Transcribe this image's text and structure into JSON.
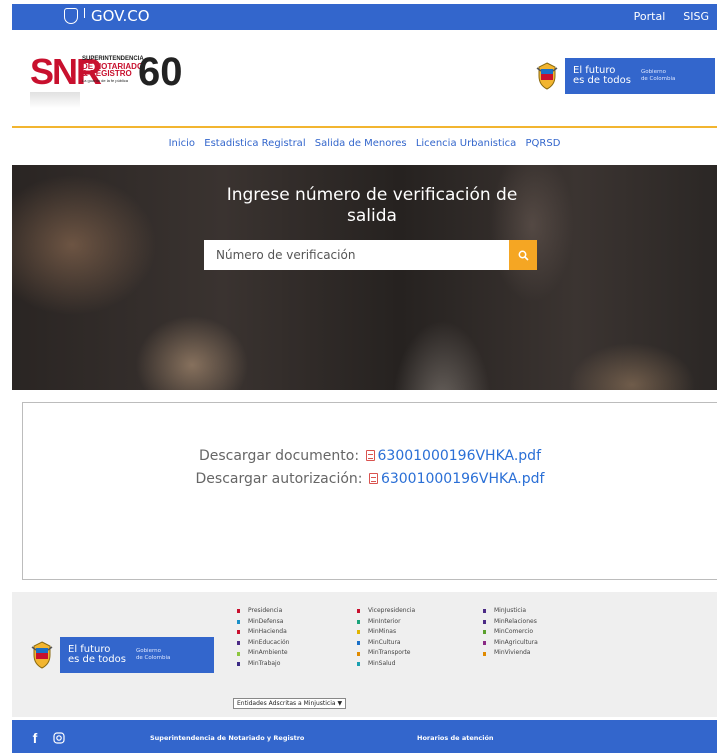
{
  "govbar": {
    "brand": "GOV.CO",
    "links": [
      "Portal",
      "SISG"
    ]
  },
  "header": {
    "snr": {
      "letters": "SNR",
      "line1": "SUPERINTENDENCIA",
      "line2": "DE NOTARIADO",
      "line3": "& REGISTRO",
      "line4": "La guarda de la fe pública",
      "anniversary": "60",
      "anniversary_small": "Años"
    },
    "futuro": {
      "main_line1": "El futuro",
      "main_line2": "es de todos",
      "small_line1": "Gobierno",
      "small_line2": "de Colombia"
    }
  },
  "nav": {
    "items": [
      "Inicio",
      "Estadistica Registral",
      "Salida de Menores",
      "Licencia Urbanistica",
      "PQRSD"
    ]
  },
  "hero": {
    "title_line1": "Ingrese número de verificación de",
    "title_line2": "salida",
    "search_placeholder": "Número de verificación"
  },
  "downloads": {
    "doc_label": "Descargar documento:",
    "doc_file": "63001000196VHKA.pdf",
    "auth_label": "Descargar autorización:",
    "auth_file": "63001000196VHKA.pdf"
  },
  "footer": {
    "futuro": {
      "main_line1": "El futuro",
      "main_line2": "es de todos",
      "small_line1": "Gobierno",
      "small_line2": "de Colombia"
    },
    "links": [
      {
        "label": "Presidencia",
        "color": "#c8102e"
      },
      {
        "label": "Vicepresidencia",
        "color": "#c8102e"
      },
      {
        "label": "MinJusticia",
        "color": "#4b2a85"
      },
      {
        "label": "MinDefensa",
        "color": "#1a8fc7"
      },
      {
        "label": "MinInterior",
        "color": "#1aa37a"
      },
      {
        "label": "MinRelaciones",
        "color": "#4b2a85"
      },
      {
        "label": "MinHacienda",
        "color": "#c8102e"
      },
      {
        "label": "MinMinas",
        "color": "#e0b400"
      },
      {
        "label": "MinComercio",
        "color": "#5aa02c"
      },
      {
        "label": "MinEducación",
        "color": "#4b2a85"
      },
      {
        "label": "MinCultura",
        "color": "#1a6fc7"
      },
      {
        "label": "MinAgricultura",
        "color": "#8a2a85"
      },
      {
        "label": "MinAmbiente",
        "color": "#8dc63f"
      },
      {
        "label": "MinTransporte",
        "color": "#e08a00"
      },
      {
        "label": "MinVivienda",
        "color": "#e08a00"
      },
      {
        "label": "MinTrabajo",
        "color": "#3b2a85"
      },
      {
        "label": "MinSalud",
        "color": "#1a9fb0"
      },
      {
        "label": "",
        "color": ""
      }
    ],
    "entities_select": "Entidades Adscritas a Minjusticia",
    "bottom_title": "Superintendencia de Notariado y Registro",
    "bottom_hours": "Horarios de atención"
  }
}
